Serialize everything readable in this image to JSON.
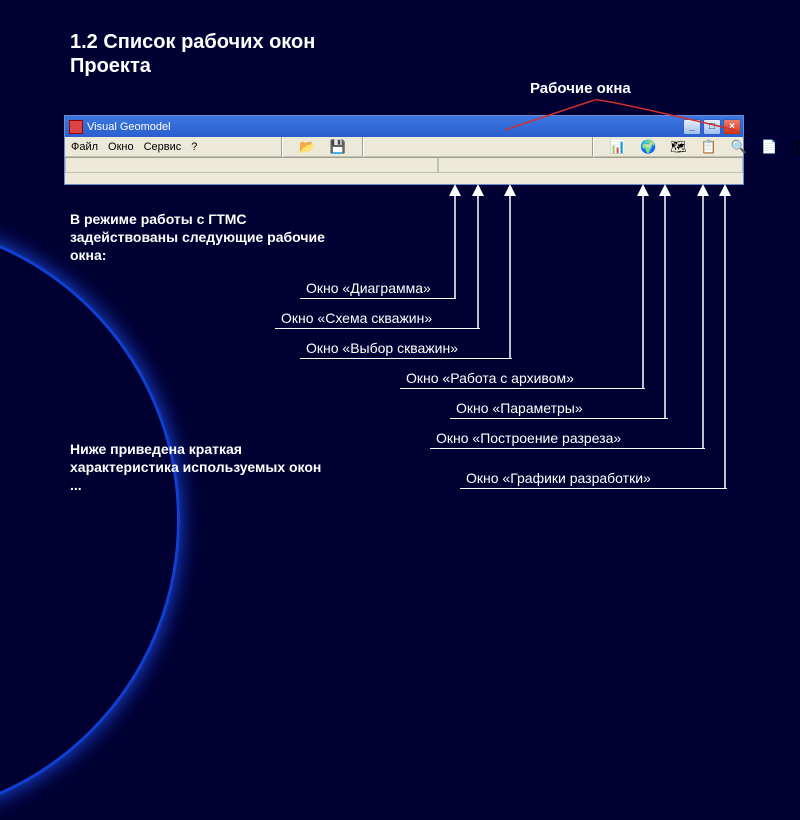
{
  "title": "1.2 Список рабочих окон Проекта",
  "top_label": "Рабочие окна",
  "window": {
    "caption": "Visual Geomodel",
    "menu": {
      "file": "Файл",
      "window": "Окно",
      "service": "Сервис",
      "help": "?"
    }
  },
  "para1": "В режиме работы с ГТМС задействованы следующие рабочие окна:",
  "para2": "Ниже приведена краткая характеристика используемых окон ...",
  "callouts": {
    "c1": "Окно «Диаграмма»",
    "c2": "Окно «Схема скважин»",
    "c3": "Окно «Выбор скважин»",
    "c4": "Окно «Работа с архивом»",
    "c5": "Окно «Параметры»",
    "c6": "Окно «Построение разреза»",
    "c7": "Окно «Графики разработки»"
  }
}
